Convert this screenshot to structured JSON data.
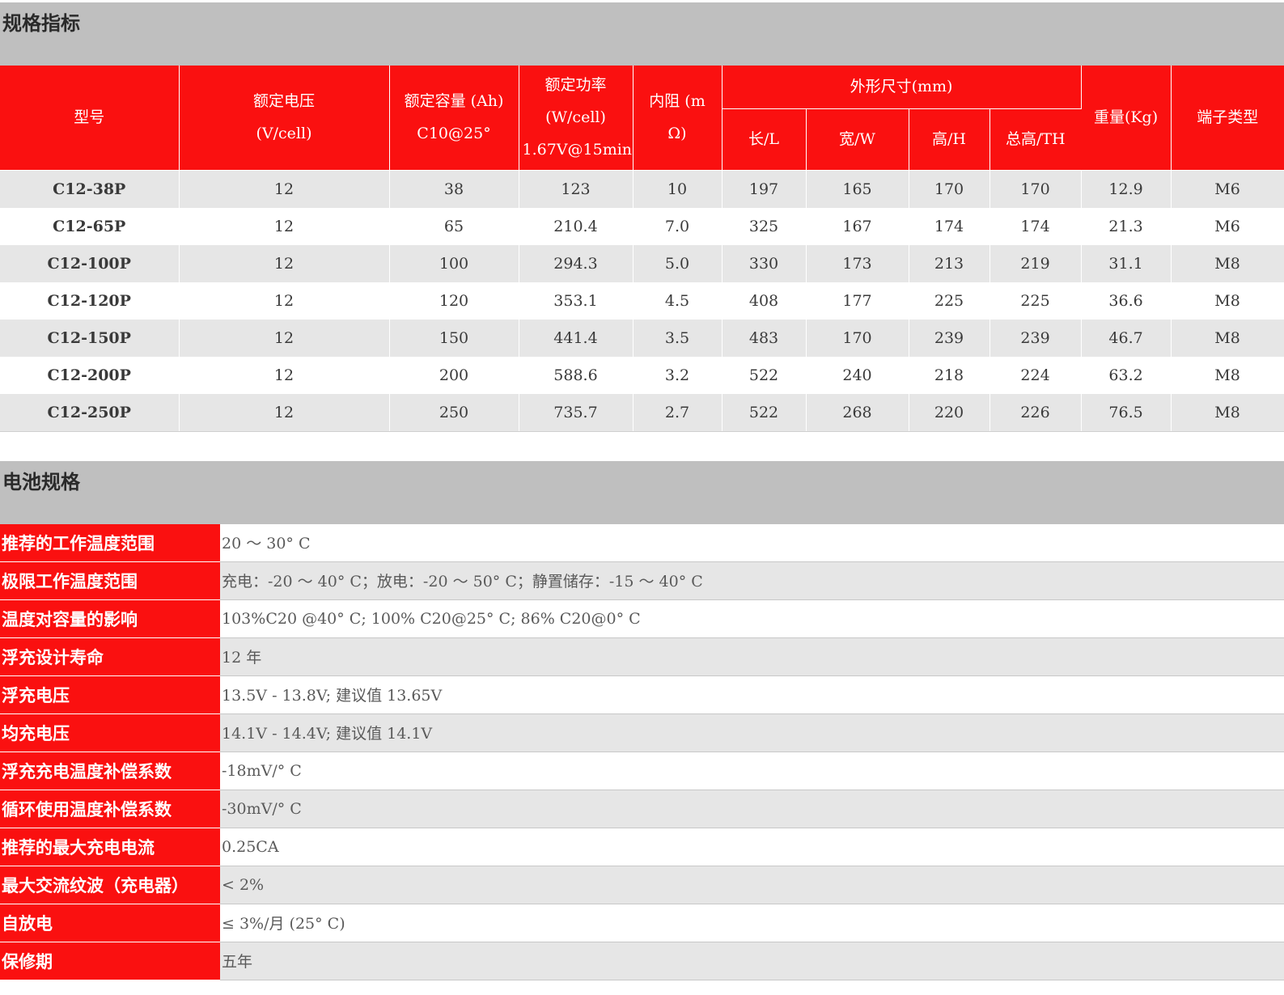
{
  "spec_section": {
    "title": "规格指标",
    "headers": {
      "model": "型号",
      "voltage": [
        "额定电压",
        "(V/cell)"
      ],
      "capacity": [
        "额定容量 (Ah)",
        "C10@25°"
      ],
      "power": [
        "额定功率",
        "(W/cell)",
        "1.67V@15min"
      ],
      "resistance": [
        "内阻 (m",
        "Ω)"
      ],
      "dimensions": "外形尺寸(mm)",
      "length": "长/L",
      "width": "宽/W",
      "height": "高/H",
      "total_height": "总高/TH",
      "weight": "重量(Kg)",
      "terminal": "端子类型"
    },
    "rows": [
      {
        "model": "C12-38P",
        "voltage": "12",
        "capacity": "38",
        "power": "123",
        "resistance": "10",
        "length": "197",
        "width": "165",
        "height": "170",
        "total_height": "170",
        "weight": "12.9",
        "terminal": "M6"
      },
      {
        "model": "C12-65P",
        "voltage": "12",
        "capacity": "65",
        "power": "210.4",
        "resistance": "7.0",
        "length": "325",
        "width": "167",
        "height": "174",
        "total_height": "174",
        "weight": "21.3",
        "terminal": "M6"
      },
      {
        "model": "C12-100P",
        "voltage": "12",
        "capacity": "100",
        "power": "294.3",
        "resistance": "5.0",
        "length": "330",
        "width": "173",
        "height": "213",
        "total_height": "219",
        "weight": "31.1",
        "terminal": "M8"
      },
      {
        "model": "C12-120P",
        "voltage": "12",
        "capacity": "120",
        "power": "353.1",
        "resistance": "4.5",
        "length": "408",
        "width": "177",
        "height": "225",
        "total_height": "225",
        "weight": "36.6",
        "terminal": "M8"
      },
      {
        "model": "C12-150P",
        "voltage": "12",
        "capacity": "150",
        "power": "441.4",
        "resistance": "3.5",
        "length": "483",
        "width": "170",
        "height": "239",
        "total_height": "239",
        "weight": "46.7",
        "terminal": "M8"
      },
      {
        "model": "C12-200P",
        "voltage": "12",
        "capacity": "200",
        "power": "588.6",
        "resistance": "3.2",
        "length": "522",
        "width": "240",
        "height": "218",
        "total_height": "224",
        "weight": "63.2",
        "terminal": "M8"
      },
      {
        "model": "C12-250P",
        "voltage": "12",
        "capacity": "250",
        "power": "735.7",
        "resistance": "2.7",
        "length": "522",
        "width": "268",
        "height": "220",
        "total_height": "226",
        "weight": "76.5",
        "terminal": "M8"
      }
    ]
  },
  "battery_section": {
    "title": "电池规格",
    "rows": [
      {
        "label": "推荐的工作温度范围",
        "value": "20 ～ 30° C"
      },
      {
        "label": "极限工作温度范围",
        "value": "充电：-20 ～ 40° C；放电：-20 ～ 50° C；静置储存：-15 ～ 40° C"
      },
      {
        "label": "温度对容量的影响",
        "value": "103%C20 @40° C; 100% C20@25° C; 86% C20@0° C"
      },
      {
        "label": "浮充设计寿命",
        "value": "12 年"
      },
      {
        "label": "浮充电压",
        "value": "13.5V - 13.8V; 建议值 13.65V"
      },
      {
        "label": "均充电压",
        "value": "14.1V - 14.4V; 建议值 14.1V"
      },
      {
        "label": "浮充充电温度补偿系数",
        "value": "-18mV/° C"
      },
      {
        "label": "循环使用温度补偿系数",
        "value": "-30mV/° C"
      },
      {
        "label": "推荐的最大充电电流",
        "value": "0.25CA"
      },
      {
        "label": "最大交流纹波（充电器）",
        "value": "< 2%"
      },
      {
        "label": "自放电",
        "value": "≤ 3%/月 (25° C)"
      },
      {
        "label": "保修期",
        "value": "五年"
      }
    ]
  },
  "colors": {
    "header_red": "#fa1010",
    "section_gray": "#bfbfbf",
    "stripe_gray": "#e6e6e6"
  }
}
